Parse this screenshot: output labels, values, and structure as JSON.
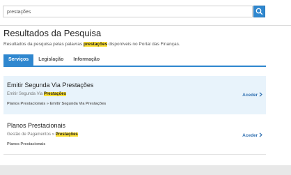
{
  "search": {
    "value": "prestações"
  },
  "header": {
    "title": "Resultados da Pesquisa",
    "subtitle_before": "Resultados da pesquisa pelas palavras",
    "subtitle_highlight": "prestações",
    "subtitle_after": "disponíveis no Portal das Finanças."
  },
  "tabs": [
    {
      "label": "Serviços",
      "active": true
    },
    {
      "label": "Legislação",
      "active": false
    },
    {
      "label": "Informação",
      "active": false
    }
  ],
  "results": [
    {
      "title": "Emitir Segunda Via Prestações",
      "meta_before": "Emitir Segunda Via",
      "meta_highlight": "Prestações",
      "path": "Planos Prestacionais » Emitir Segunda Via Prestações",
      "action": "Aceder"
    },
    {
      "title": "Planos Prestacionais",
      "meta_before": "Gestão de Pagamentos »",
      "meta_highlight": "Prestações",
      "path": "Planos Prestacionais",
      "action": "Aceder"
    }
  ],
  "colors": {
    "accent": "#2f87cf",
    "highlight": "#fde033",
    "result_hover": "#e8f3fb"
  },
  "icons": {
    "search_button": "search-icon",
    "access_arrow": "chevron-right-icon"
  }
}
